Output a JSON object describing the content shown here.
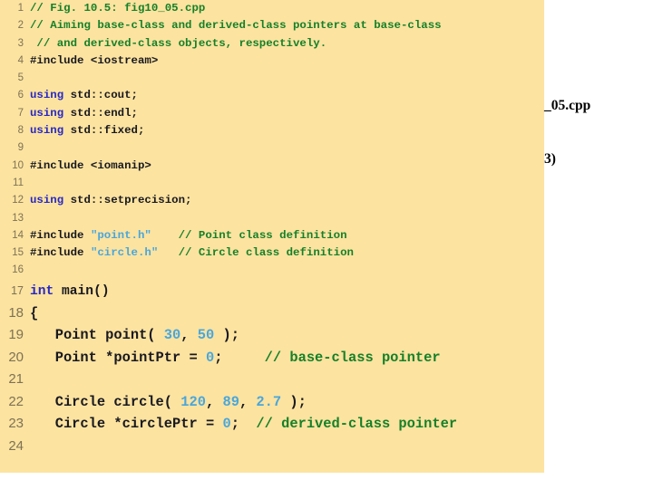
{
  "panel": {
    "background_color": "#FCE3A0",
    "lineno_color": "#7E7254"
  },
  "colors": {
    "comment": "#168028",
    "keyword": "#2727C4",
    "preprocessor": "#2727C4",
    "string": "#49A6DC",
    "number": "#49A6DC",
    "plain": "#18181F",
    "overlay_text": "#000000"
  },
  "overlay": {
    "line1": "_05.cpp",
    "line2": "3)"
  },
  "code": {
    "lines": [
      {
        "number": "1",
        "size": "small",
        "tokens": [
          {
            "t": "// Fig. 10.5: fig10_05.cpp",
            "c": "comment"
          }
        ]
      },
      {
        "number": "2",
        "size": "small",
        "tokens": [
          {
            "t": "// Aiming base-class and derived-class pointers at base-class",
            "c": "comment"
          }
        ]
      },
      {
        "number": "3",
        "size": "small",
        "tokens": [
          {
            "t": " // and derived-class objects, respectively.",
            "c": "comment"
          }
        ]
      },
      {
        "number": "4",
        "size": "small",
        "tokens": [
          {
            "t": "#include",
            "c": "preprocessor"
          },
          {
            "t": " <iostream>",
            "c": "plain"
          }
        ]
      },
      {
        "number": "5",
        "size": "small",
        "tokens": []
      },
      {
        "number": "6",
        "size": "small",
        "tokens": [
          {
            "t": "using",
            "c": "keyword"
          },
          {
            "t": " std::cout;",
            "c": "plain"
          }
        ]
      },
      {
        "number": "7",
        "size": "small",
        "tokens": [
          {
            "t": "using",
            "c": "keyword"
          },
          {
            "t": " std::endl;",
            "c": "plain"
          }
        ]
      },
      {
        "number": "8",
        "size": "small",
        "tokens": [
          {
            "t": "using",
            "c": "keyword"
          },
          {
            "t": " std::fixed;",
            "c": "plain"
          }
        ]
      },
      {
        "number": "9",
        "size": "small",
        "tokens": []
      },
      {
        "number": "10",
        "size": "small",
        "tokens": [
          {
            "t": "#include",
            "c": "preprocessor"
          },
          {
            "t": " <iomanip>",
            "c": "plain"
          }
        ]
      },
      {
        "number": "11",
        "size": "small",
        "tokens": []
      },
      {
        "number": "12",
        "size": "small",
        "tokens": [
          {
            "t": "using",
            "c": "keyword"
          },
          {
            "t": " std::setprecision;",
            "c": "plain"
          }
        ]
      },
      {
        "number": "13",
        "size": "small",
        "tokens": []
      },
      {
        "number": "14",
        "size": "small",
        "tokens": [
          {
            "t": "#include",
            "c": "preprocessor"
          },
          {
            "t": " ",
            "c": "plain"
          },
          {
            "t": "\"point.h\"",
            "c": "string"
          },
          {
            "t": "    ",
            "c": "plain"
          },
          {
            "t": "// Point class definition",
            "c": "comment"
          }
        ]
      },
      {
        "number": "15",
        "size": "small",
        "tokens": [
          {
            "t": "#include",
            "c": "preprocessor"
          },
          {
            "t": " ",
            "c": "plain"
          },
          {
            "t": "\"circle.h\"",
            "c": "string"
          },
          {
            "t": "   ",
            "c": "plain"
          },
          {
            "t": "// Circle class definition",
            "c": "comment"
          }
        ]
      },
      {
        "number": "16",
        "size": "small",
        "tokens": []
      },
      {
        "number": "17",
        "size": "medium",
        "tokens": [
          {
            "t": "int",
            "c": "keyword"
          },
          {
            "t": " main()",
            "c": "plain"
          }
        ]
      },
      {
        "number": "18",
        "size": "large",
        "tokens": [
          {
            "t": "{",
            "c": "plain"
          }
        ]
      },
      {
        "number": "19",
        "size": "large",
        "tokens": [
          {
            "t": "   Point point( ",
            "c": "plain"
          },
          {
            "t": "30",
            "c": "number"
          },
          {
            "t": ", ",
            "c": "plain"
          },
          {
            "t": "50",
            "c": "number"
          },
          {
            "t": " );",
            "c": "plain"
          }
        ]
      },
      {
        "number": "20",
        "size": "large",
        "tokens": [
          {
            "t": "   Point *pointPtr = ",
            "c": "plain"
          },
          {
            "t": "0",
            "c": "number"
          },
          {
            "t": ";     ",
            "c": "plain"
          },
          {
            "t": "// base-class pointer",
            "c": "comment"
          }
        ]
      },
      {
        "number": "21",
        "size": "large",
        "tokens": []
      },
      {
        "number": "22",
        "size": "large",
        "tokens": [
          {
            "t": "   Circle circle( ",
            "c": "plain"
          },
          {
            "t": "120",
            "c": "number"
          },
          {
            "t": ", ",
            "c": "plain"
          },
          {
            "t": "89",
            "c": "number"
          },
          {
            "t": ", ",
            "c": "plain"
          },
          {
            "t": "2.7",
            "c": "number"
          },
          {
            "t": " );",
            "c": "plain"
          }
        ]
      },
      {
        "number": "23",
        "size": "large",
        "tokens": [
          {
            "t": "   Circle *circlePtr = ",
            "c": "plain"
          },
          {
            "t": "0",
            "c": "number"
          },
          {
            "t": ";  ",
            "c": "plain"
          },
          {
            "t": "// derived-class pointer",
            "c": "comment"
          }
        ]
      },
      {
        "number": "24",
        "size": "large",
        "tokens": []
      }
    ]
  }
}
